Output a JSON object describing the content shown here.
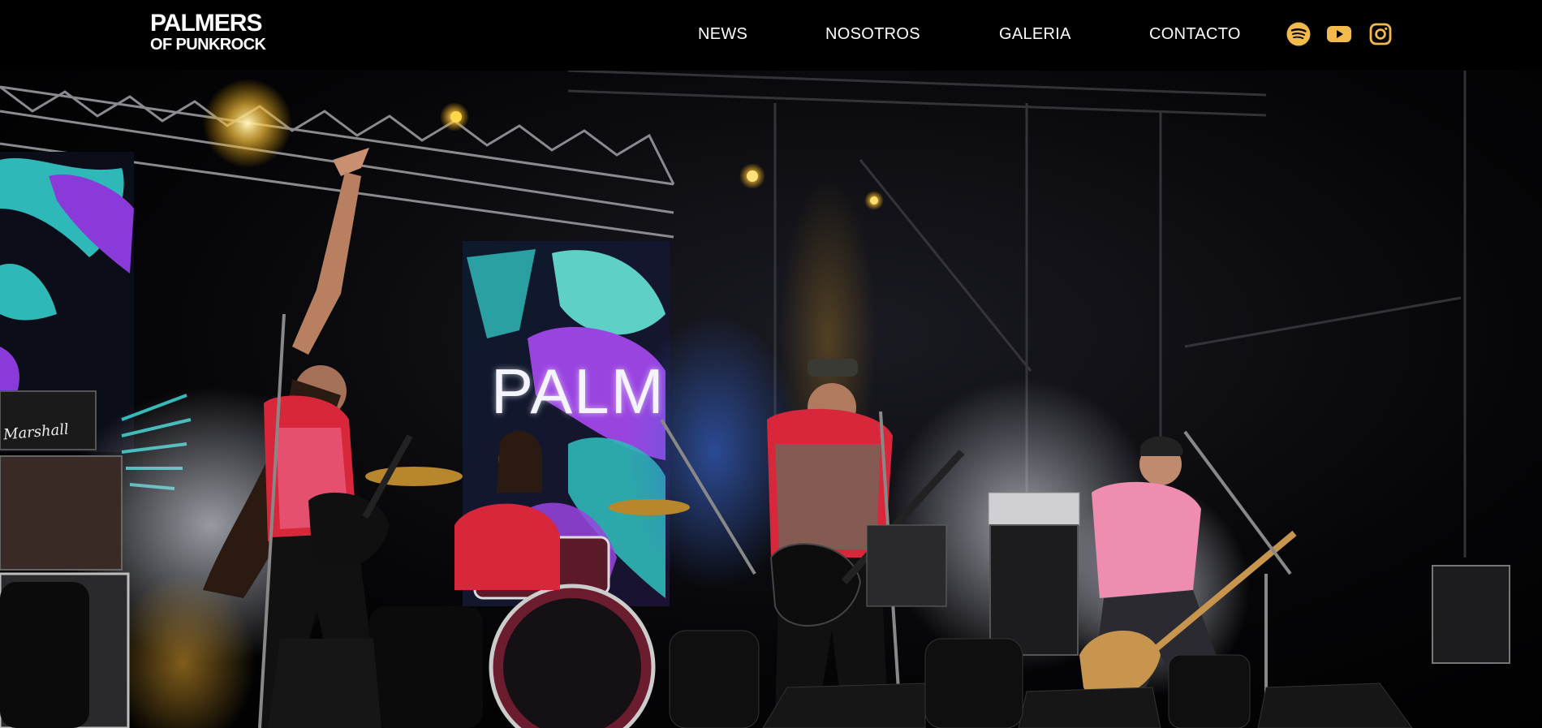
{
  "brand": {
    "logo_line1": "PALMERS",
    "logo_line2": "OF PUNKROCK"
  },
  "nav": {
    "items": [
      {
        "label": "NEWS"
      },
      {
        "label": "NOSOTROS"
      },
      {
        "label": "GALERIA"
      },
      {
        "label": "CONTACTO"
      }
    ]
  },
  "social": {
    "icons": [
      "spotify-icon",
      "youtube-icon",
      "instagram-icon"
    ],
    "accent_color": "#f2b94b"
  },
  "hero": {
    "screen_text": "PALM",
    "amp_brand": "Marshall"
  },
  "colors": {
    "header_bg": "#000000",
    "nav_text": "#ffffff"
  }
}
